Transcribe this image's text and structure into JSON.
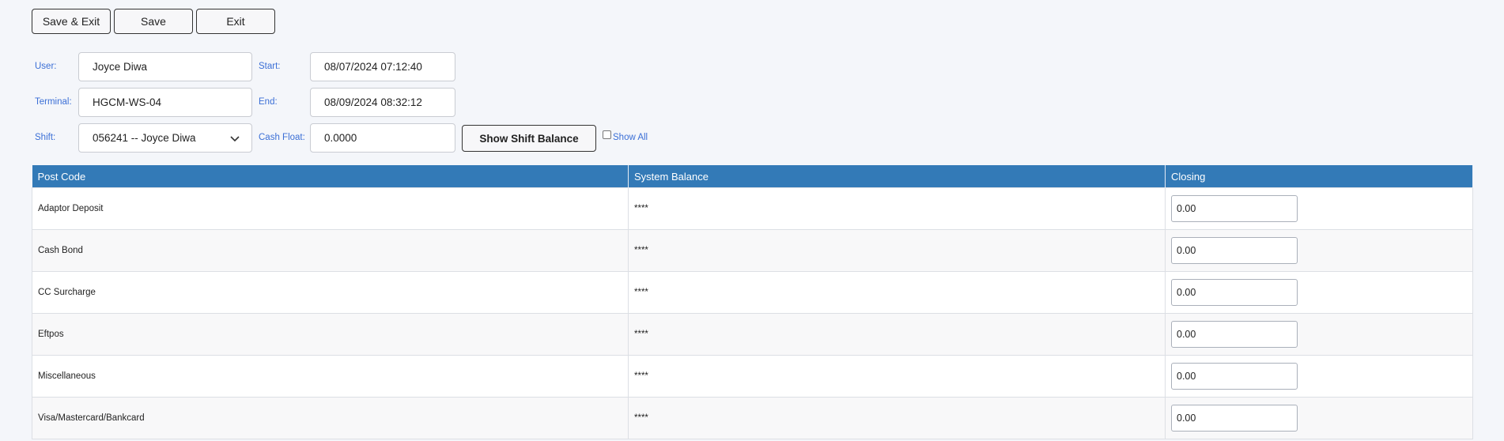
{
  "toolbar": {
    "save_exit": "Save & Exit",
    "save": "Save",
    "exit": "Exit"
  },
  "form": {
    "user_label": "User:",
    "user_value": "Joyce Diwa",
    "terminal_label": "Terminal:",
    "terminal_value": "HGCM-WS-04",
    "shift_label": "Shift:",
    "shift_value": "056241 -- Joyce Diwa",
    "start_label": "Start:",
    "start_value": "08/07/2024 07:12:40",
    "end_label": "End:",
    "end_value": "08/09/2024 08:32:12",
    "cash_float_label": "Cash Float:",
    "cash_float_value": "0.0000",
    "show_shift_balance": "Show Shift Balance",
    "show_all_label": "Show All",
    "show_all_checked": false
  },
  "table": {
    "headers": [
      "Post Code",
      "System Balance",
      "Closing"
    ],
    "rows": [
      {
        "post_code": "Adaptor Deposit",
        "system_balance": "****",
        "closing": "0.00"
      },
      {
        "post_code": "Cash Bond",
        "system_balance": "****",
        "closing": "0.00"
      },
      {
        "post_code": "CC Surcharge",
        "system_balance": "****",
        "closing": "0.00"
      },
      {
        "post_code": "Eftpos",
        "system_balance": "****",
        "closing": "0.00"
      },
      {
        "post_code": "Miscellaneous",
        "system_balance": "****",
        "closing": "0.00"
      },
      {
        "post_code": "Visa/Mastercard/Bankcard",
        "system_balance": "****",
        "closing": "0.00"
      }
    ]
  },
  "colors": {
    "header_bg": "#337ab7",
    "label": "#3b6fd6",
    "page_bg": "#f4f6fa"
  }
}
